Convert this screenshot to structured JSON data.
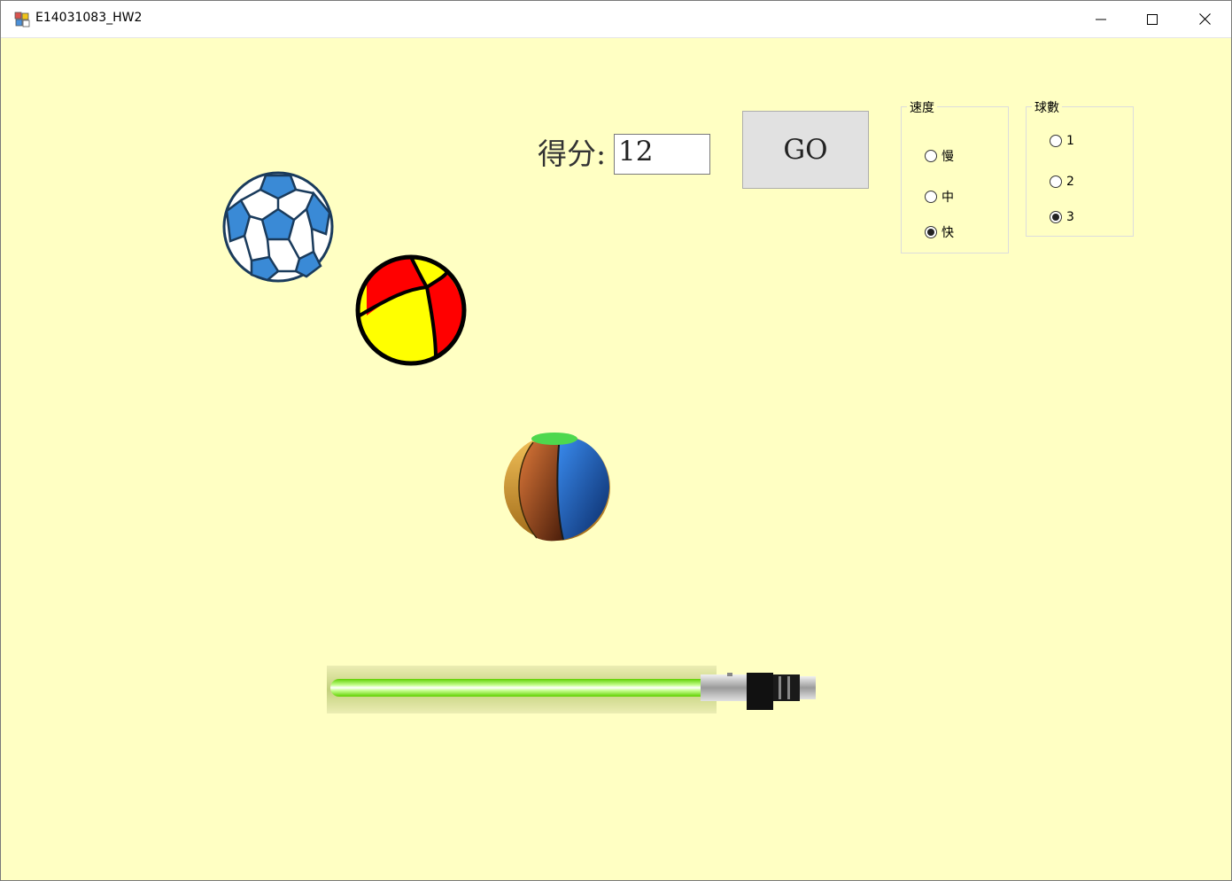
{
  "window": {
    "title": "E14031083_HW2"
  },
  "score": {
    "label": "得分:",
    "value": "12"
  },
  "go_button": {
    "label": "GO"
  },
  "speed_group": {
    "title": "速度",
    "options": [
      {
        "label": "慢",
        "checked": false
      },
      {
        "label": "中",
        "checked": false
      },
      {
        "label": "快",
        "checked": true
      }
    ]
  },
  "count_group": {
    "title": "球數",
    "options": [
      {
        "label": "1",
        "checked": false
      },
      {
        "label": "2",
        "checked": false
      },
      {
        "label": "3",
        "checked": true
      }
    ]
  },
  "colors": {
    "background": "#ffffc3",
    "saber_blade": "#7cfc00"
  },
  "icons": [
    "app-icon",
    "minimize-icon",
    "maximize-icon",
    "close-icon",
    "soccer-ball-icon",
    "beach-ball-red-yellow-icon",
    "beach-ball-multicolor-icon",
    "lightsaber-icon"
  ]
}
